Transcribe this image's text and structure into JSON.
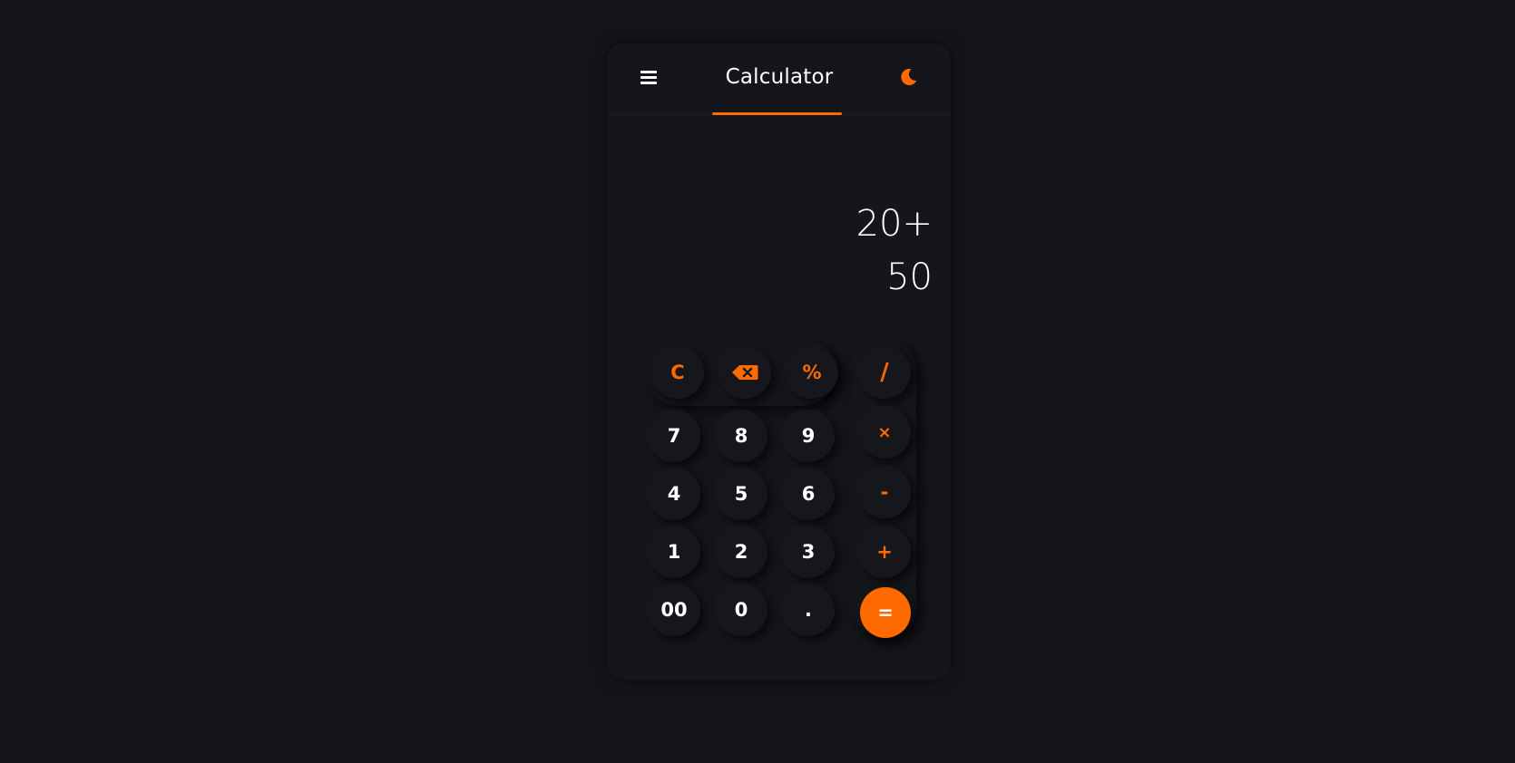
{
  "header": {
    "title": "Calculator",
    "menu_icon": "hamburger-menu-icon",
    "theme_icon": "moon-icon",
    "accent_color": "#ff6a00"
  },
  "display": {
    "expression": "20+",
    "result": "50"
  },
  "keypad": {
    "functions": [
      {
        "label": "C",
        "name": "clear-button"
      },
      {
        "label": "",
        "name": "backspace-button",
        "icon": "backspace-icon"
      },
      {
        "label": "%",
        "name": "percent-button"
      }
    ],
    "digits": [
      [
        "7",
        "8",
        "9"
      ],
      [
        "4",
        "5",
        "6"
      ],
      [
        "1",
        "2",
        "3"
      ],
      [
        "00",
        "0",
        "."
      ]
    ],
    "operators": [
      {
        "label": "/",
        "name": "divide-button"
      },
      {
        "label": "×",
        "name": "multiply-button"
      },
      {
        "label": "-",
        "name": "subtract-button"
      },
      {
        "label": "+",
        "name": "add-button"
      },
      {
        "label": "=",
        "name": "equals-button"
      }
    ]
  },
  "colors": {
    "background": "#14151a",
    "panel": "#15161b",
    "accent": "#ff6a00",
    "text": "#ffffff"
  }
}
